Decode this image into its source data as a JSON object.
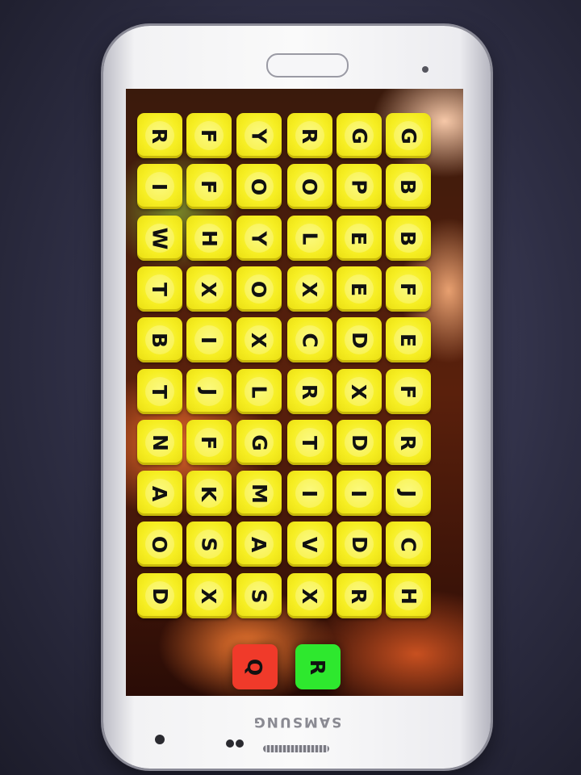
{
  "device": {
    "brand": "SAMSUNG"
  },
  "board": {
    "columns": [
      [
        "R",
        "I",
        "W",
        "T",
        "B",
        "T",
        "N",
        "A",
        "O",
        "D"
      ],
      [
        "F",
        "F",
        "H",
        "X",
        "I",
        "J",
        "F",
        "K",
        "S",
        "X"
      ],
      [
        "Y",
        "O",
        "Y",
        "O",
        "X",
        "L",
        "G",
        "M",
        "A",
        "S"
      ],
      [
        "R",
        "O",
        "L",
        "X",
        "C",
        "R",
        "T",
        "I",
        "V",
        "X"
      ],
      [
        "G",
        "P",
        "E",
        "E",
        "D",
        "X",
        "D",
        "I",
        "D",
        "R"
      ],
      [
        "G",
        "B",
        "B",
        "F",
        "E",
        "F",
        "R",
        "J",
        "C",
        "H"
      ]
    ]
  },
  "controls": {
    "quit_label": "Q",
    "restart_label": "R"
  },
  "colors": {
    "tile": "#f6ee22",
    "quit_button": "#f03a2a",
    "restart_button": "#2ee82e"
  }
}
